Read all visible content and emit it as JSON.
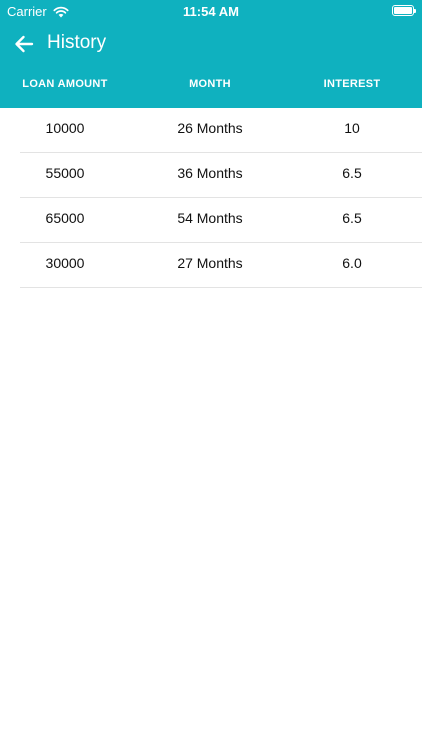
{
  "status_bar": {
    "carrier": "Carrier",
    "time": "11:54 AM",
    "wifi_icon": "wifi-icon",
    "battery_icon": "battery-icon"
  },
  "nav": {
    "title": "History",
    "back_icon": "arrow-left-icon"
  },
  "table": {
    "headers": [
      "LOAN AMOUNT",
      "MONTH",
      "INTEREST"
    ],
    "rows": [
      {
        "loan_amount": "10000",
        "month": "26 Months",
        "interest": "10"
      },
      {
        "loan_amount": "55000",
        "month": "36 Months",
        "interest": "6.5"
      },
      {
        "loan_amount": "65000",
        "month": "54 Months",
        "interest": "6.5"
      },
      {
        "loan_amount": "30000",
        "month": "27 Months",
        "interest": "6.0"
      }
    ]
  },
  "colors": {
    "header_background": "#0fb1bf",
    "header_text": "#ffffff",
    "row_divider": "#e3e3e3",
    "body_text": "#111111"
  }
}
